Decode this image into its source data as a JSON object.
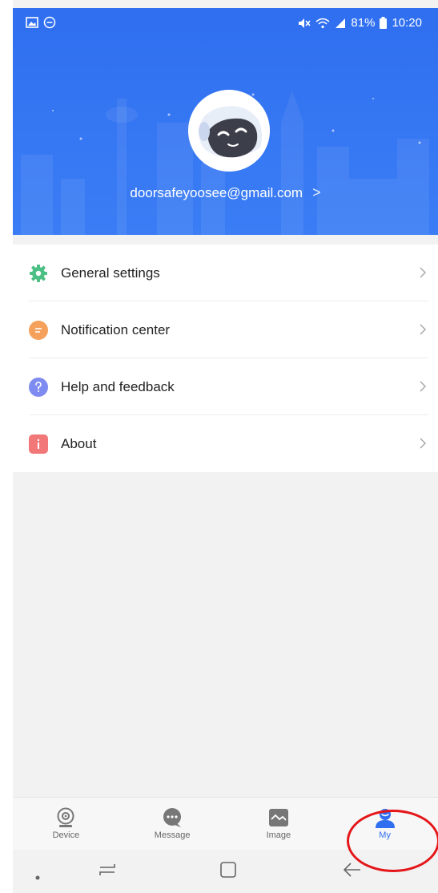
{
  "status_bar": {
    "battery": "81%",
    "time": "10:20"
  },
  "profile": {
    "email": "doorsafeyoosee@gmail.com",
    "chevron": ">"
  },
  "menu": [
    {
      "label": "General settings",
      "icon": "gear-icon",
      "color": "#4cbf84"
    },
    {
      "label": "Notification center",
      "icon": "message-icon",
      "color": "#f5a15b"
    },
    {
      "label": "Help and feedback",
      "icon": "help-icon",
      "color": "#7e8bf0"
    },
    {
      "label": "About",
      "icon": "info-icon",
      "color": "#f27778"
    }
  ],
  "tabs": [
    {
      "label": "Device",
      "icon": "camera-icon",
      "active": false
    },
    {
      "label": "Message",
      "icon": "chat-icon",
      "active": false
    },
    {
      "label": "Image",
      "icon": "image-icon",
      "active": false
    },
    {
      "label": "My",
      "icon": "person-icon",
      "active": true
    }
  ],
  "colors": {
    "header_blue": "#2f6ff0",
    "active_tab": "#2f6ff0",
    "highlight": "#e4161a"
  }
}
